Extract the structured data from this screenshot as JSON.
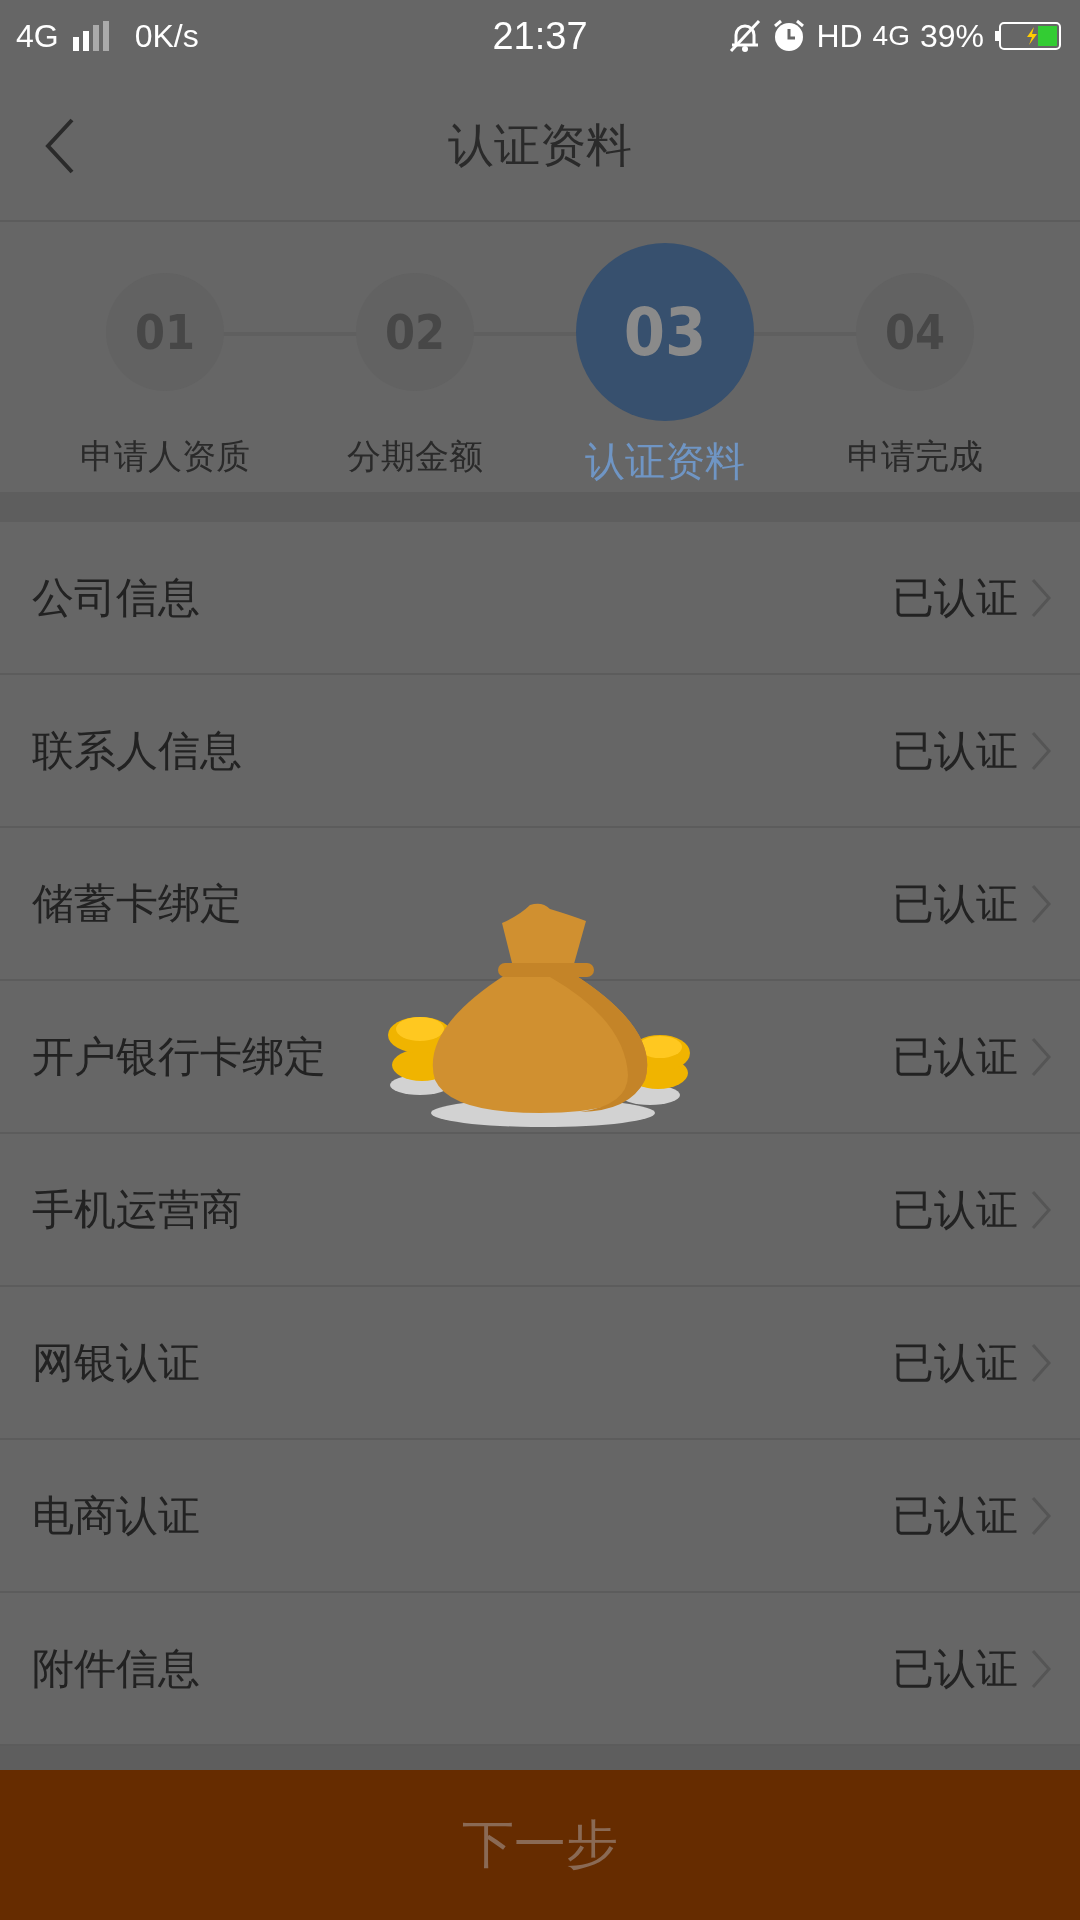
{
  "status_bar": {
    "network": "4G",
    "speed": "0K/s",
    "time": "21:37",
    "hd": "HD",
    "network_right": "4G",
    "battery": "39%"
  },
  "header": {
    "title": "认证资料"
  },
  "steps": [
    {
      "number": "01",
      "label": "申请人资质",
      "selected": false
    },
    {
      "number": "02",
      "label": "分期金额",
      "selected": false
    },
    {
      "number": "03",
      "label": "认证资料",
      "selected": true
    },
    {
      "number": "04",
      "label": "申请完成",
      "selected": false
    }
  ],
  "items": [
    {
      "label": "公司信息",
      "status": "已认证"
    },
    {
      "label": "联系人信息",
      "status": "已认证"
    },
    {
      "label": "储蓄卡绑定",
      "status": "已认证"
    },
    {
      "label": "开户银行卡绑定",
      "status": "已认证"
    },
    {
      "label": "手机运营商",
      "status": "已认证"
    },
    {
      "label": "网银认证",
      "status": "已认证"
    },
    {
      "label": "电商认证",
      "status": "已认证"
    },
    {
      "label": "附件信息",
      "status": "已认证"
    }
  ],
  "next_button": "下一步"
}
